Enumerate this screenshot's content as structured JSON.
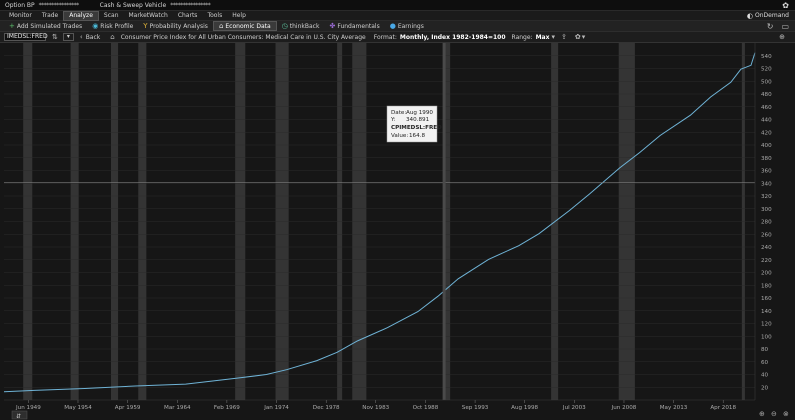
{
  "top_bar": {
    "option_bp_label": "Option BP",
    "option_bp_value": "****************",
    "cash_label": "Cash & Sweep Vehicle",
    "cash_value": "****************"
  },
  "menu": {
    "items": [
      "Monitor",
      "Trade",
      "Analyze",
      "Scan",
      "MarketWatch",
      "Charts",
      "Tools",
      "Help"
    ],
    "active": "Analyze",
    "ondemand": "OnDemand"
  },
  "submenu": {
    "items": [
      {
        "label": "Add Simulated Trades",
        "icon": "plus-icon"
      },
      {
        "label": "Risk Profile",
        "icon": "risk-profile-icon"
      },
      {
        "label": "Probability Analysis",
        "icon": "probability-icon"
      },
      {
        "label": "Economic Data",
        "icon": "bank-icon"
      },
      {
        "label": "thinkBack",
        "icon": "clock-icon"
      },
      {
        "label": "Fundamentals",
        "icon": "fundamentals-icon"
      },
      {
        "label": "Earnings",
        "icon": "lightbulb-icon"
      }
    ],
    "active": "Economic Data"
  },
  "toolbar": {
    "symbol": "IMEDSL:FRED",
    "back_label": "Back",
    "title": "Consumer Price Index for All Urban Consumers: Medical Care in U.S. City Average",
    "format_label": "Format:",
    "format_value": "Monthly, Index 1982-1984=100",
    "range_label": "Range:",
    "range_value": "Max"
  },
  "tooltip": {
    "date_label": "Date:",
    "date_value": "Aug 1990",
    "y_label": "Y:",
    "y_value": "340.891",
    "series": "CPIMEDSL:FRED",
    "value_label": "Value:",
    "value_value": "164.8"
  },
  "colors": {
    "line": "#6fb3d6",
    "background": "#161616",
    "recession_band": "#343434",
    "grid": "#2a2a2a",
    "crosshair": "#7a7a7a"
  },
  "chart_data": {
    "type": "line",
    "title": "Consumer Price Index for All Urban Consumers: Medical Care in U.S. City Average",
    "xlabel": "",
    "ylabel": "",
    "x_range": [
      1947.0,
      2021.4
    ],
    "ylim": [
      0,
      560
    ],
    "y_ticks": [
      20,
      40,
      60,
      80,
      100,
      120,
      140,
      160,
      180,
      200,
      220,
      240,
      260,
      280,
      300,
      320,
      340,
      360,
      380,
      400,
      420,
      440,
      460,
      480,
      500,
      520,
      540
    ],
    "x_ticks": [
      {
        "label": "Jun 1949",
        "t": 1949.42
      },
      {
        "label": "May 1954",
        "t": 1954.33
      },
      {
        "label": "Apr 1959",
        "t": 1959.25
      },
      {
        "label": "Mar 1964",
        "t": 1964.17
      },
      {
        "label": "Feb 1969",
        "t": 1969.08
      },
      {
        "label": "Jan 1974",
        "t": 1974.0
      },
      {
        "label": "Dec 1978",
        "t": 1978.92
      },
      {
        "label": "Nov 1983",
        "t": 1983.83
      },
      {
        "label": "Oct 1988",
        "t": 1988.75
      },
      {
        "label": "Sep 1993",
        "t": 1993.67
      },
      {
        "label": "Aug 1998",
        "t": 1998.58
      },
      {
        "label": "Jul 2003",
        "t": 2003.5
      },
      {
        "label": "Jun 2008",
        "t": 2008.42
      },
      {
        "label": "May 2013",
        "t": 2013.33
      },
      {
        "label": "Apr 2018",
        "t": 2018.25
      }
    ],
    "recessions": [
      [
        1948.9,
        1949.8
      ],
      [
        1953.6,
        1954.4
      ],
      [
        1957.6,
        1958.3
      ],
      [
        1960.3,
        1961.1
      ],
      [
        1969.9,
        1970.9
      ],
      [
        1973.9,
        1975.2
      ],
      [
        1980.0,
        1980.5
      ],
      [
        1981.5,
        1982.9
      ],
      [
        1990.5,
        1991.2
      ],
      [
        2001.2,
        2001.9
      ],
      [
        2007.9,
        2009.5
      ],
      [
        2020.1,
        2020.4
      ]
    ],
    "series": [
      {
        "x": [
          1947.0,
          1950.0,
          1955.0,
          1960.0,
          1965.0,
          1970.0,
          1973.0,
          1975.0,
          1978.0,
          1980.0,
          1982.0,
          1985.0,
          1988.0,
          1990.0,
          1992.0,
          1995.0,
          1998.0,
          2000.0,
          2003.0,
          2005.0,
          2008.0,
          2010.0,
          2012.0,
          2015.0,
          2017.0,
          2019.0,
          2020.0,
          2021.0,
          2021.4
        ],
        "y": [
          13.0,
          15.0,
          18.0,
          22.0,
          25.0,
          34.0,
          40.0,
          47.5,
          61.8,
          74.9,
          92.5,
          113.5,
          138.6,
          162.8,
          190.1,
          220.5,
          242.1,
          260.8,
          297.1,
          323.2,
          364.1,
          388.4,
          414.9,
          446.8,
          475.3,
          498.4,
          518.9,
          525.0,
          545.0
        ]
      }
    ],
    "crosshair_y": 340.891,
    "crosshair_x": 1990.6
  }
}
